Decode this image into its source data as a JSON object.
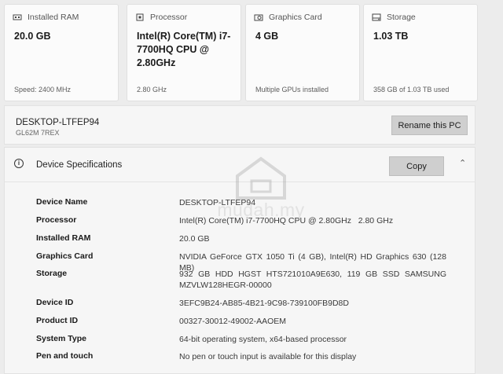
{
  "cards": [
    {
      "icon": "ram-icon",
      "title": "Installed RAM",
      "value": "20.0 GB",
      "sub": "Speed: 2400 MHz"
    },
    {
      "icon": "processor-icon",
      "title": "Processor",
      "value": "Intel(R) Core(TM) i7-7700HQ CPU @ 2.80GHz",
      "sub": "2.80 GHz"
    },
    {
      "icon": "graphics-card-icon",
      "title": "Graphics Card",
      "value": "4 GB",
      "sub": "Multiple GPUs installed"
    },
    {
      "icon": "storage-icon",
      "title": "Storage",
      "value": "1.03 TB",
      "sub": "358 GB of 1.03 TB used"
    }
  ],
  "pc": {
    "name": "DESKTOP-LTFEP94",
    "model": "GL62M 7REX",
    "rename_label": "Rename this PC"
  },
  "specs": {
    "title": "Device Specifications",
    "copy_label": "Copy",
    "rows": [
      {
        "label": "Device Name",
        "value": "DESKTOP-LTFEP94"
      },
      {
        "label": "Processor",
        "value": "Intel(R) Core(TM) i7-7700HQ CPU @ 2.80GHz   2.80 GHz"
      },
      {
        "label": "Installed RAM",
        "value": "20.0 GB"
      },
      {
        "label": "Graphics Card",
        "value": "NVIDIA GeForce GTX 1050 Ti (4 GB), Intel(R) HD Graphics 630 (128 MB)"
      },
      {
        "label": "Storage",
        "value": "932 GB HDD HGST HTS721010A9E630, 119 GB SSD SAMSUNG MZVLW128HEGR-00000"
      },
      {
        "label": "Device ID",
        "value": "3EFC9B24-AB85-4B21-9C98-739100FB9D8D"
      },
      {
        "label": "Product ID",
        "value": "00327-30012-49002-AAOEM"
      },
      {
        "label": "System Type",
        "value": "64-bit operating system, x64-based processor"
      },
      {
        "label": "Pen and touch",
        "value": "No pen or touch input is available for this display"
      }
    ]
  },
  "watermark": {
    "text": "mudah.my"
  }
}
